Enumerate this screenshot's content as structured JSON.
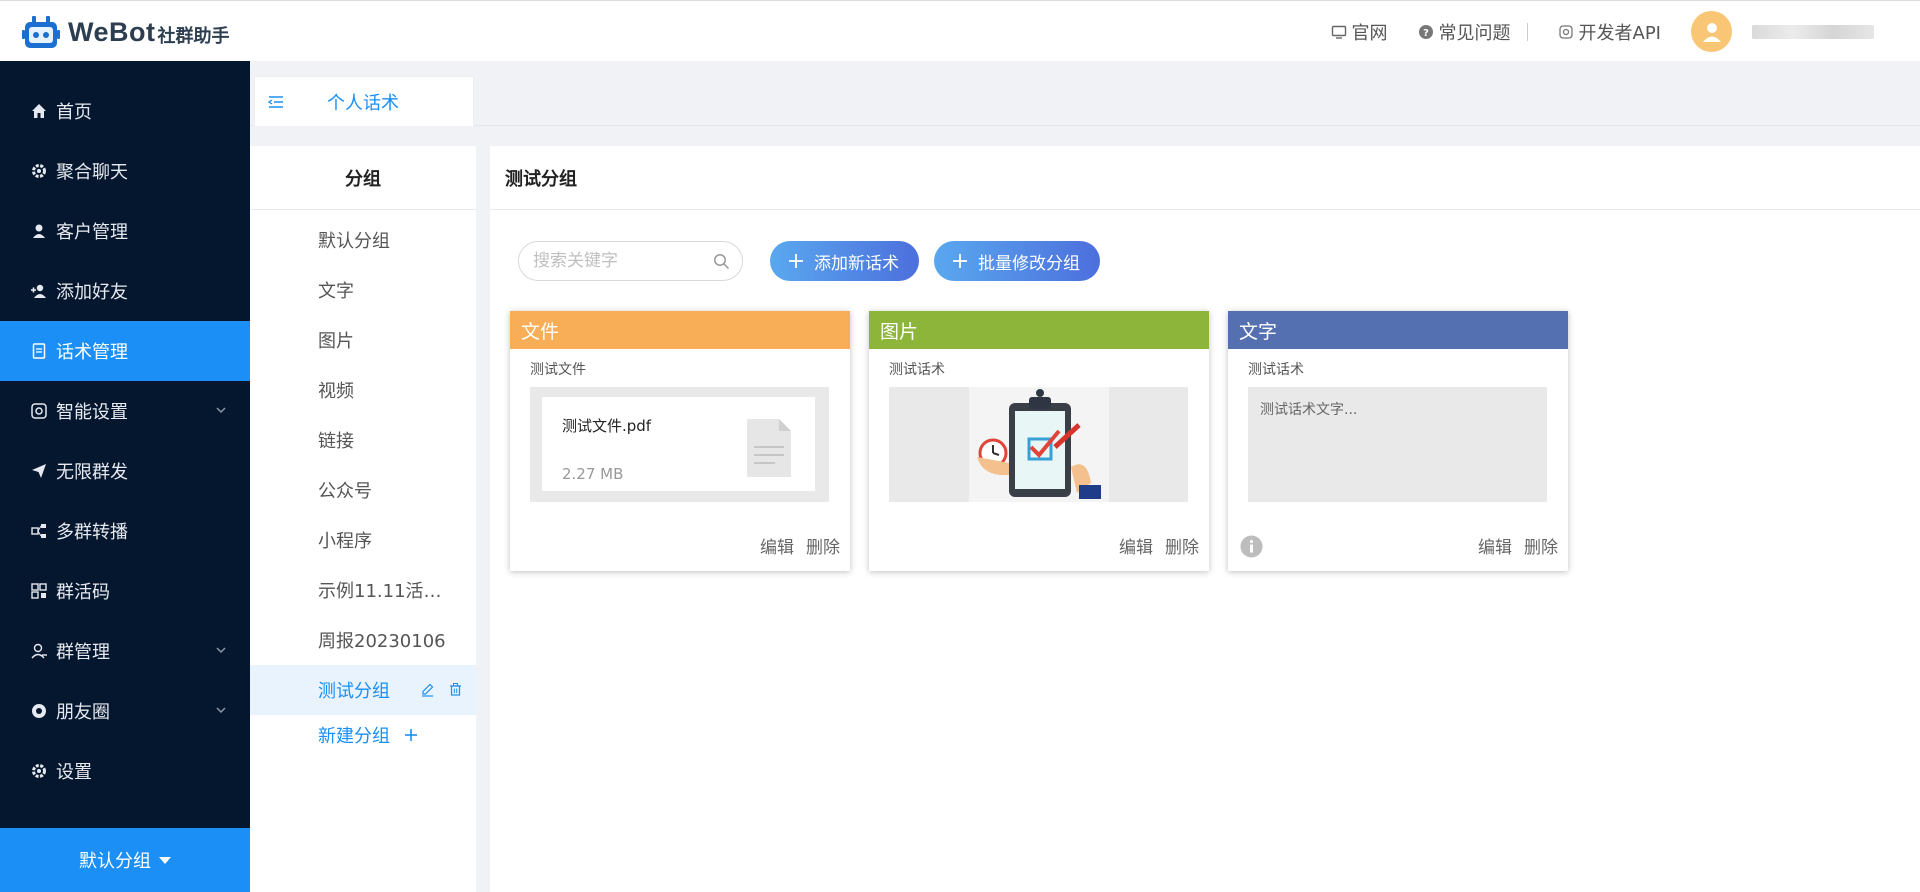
{
  "app": {
    "brand": "WeBot",
    "brand_sub": "社群助手",
    "accent": "#1b8ff5",
    "sidebar_bg": "#05172f"
  },
  "header": {
    "links": [
      {
        "label": "官网",
        "icon": "monitor-icon"
      },
      {
        "label": "常见问题",
        "icon": "question-circle-icon"
      },
      {
        "label": "开发者API",
        "icon": "api-icon"
      }
    ]
  },
  "sidebar": {
    "items": [
      {
        "label": "首页",
        "icon": "home-icon"
      },
      {
        "label": "聚合聊天",
        "icon": "gear-icon"
      },
      {
        "label": "客户管理",
        "icon": "user-icon"
      },
      {
        "label": "添加好友",
        "icon": "add-user-icon"
      },
      {
        "label": "话术管理",
        "icon": "document-icon",
        "active": true
      },
      {
        "label": "智能设置",
        "icon": "smart-settings-icon",
        "expandable": true
      },
      {
        "label": "无限群发",
        "icon": "send-icon"
      },
      {
        "label": "多群转播",
        "icon": "broadcast-icon"
      },
      {
        "label": "群活码",
        "icon": "qrcode-icon"
      },
      {
        "label": "群管理",
        "icon": "group-icon",
        "expandable": true
      },
      {
        "label": "朋友圈",
        "icon": "aperture-icon",
        "expandable": true
      },
      {
        "label": "设置",
        "icon": "gear-icon"
      }
    ],
    "bottom_label": "默认分组"
  },
  "tabs": [
    {
      "label": "个人话术",
      "active": true
    }
  ],
  "groups": {
    "title": "分组",
    "items": [
      "默认分组",
      "文字",
      "图片",
      "视频",
      "链接",
      "公众号",
      "小程序",
      "示例11.11活…",
      "周报20230106",
      "测试分组"
    ],
    "active_index": 9,
    "new_label": "新建分组"
  },
  "content": {
    "title": "测试分组",
    "search_placeholder": "搜索关键字",
    "add_button": "添加新话术",
    "batch_button": "批量修改分组",
    "cards": [
      {
        "type_label": "文件",
        "color": "#f7ae56",
        "name": "测试文件",
        "file_name": "测试文件.pdf",
        "file_size": "2.27 MB",
        "edit": "编辑",
        "delete": "删除"
      },
      {
        "type_label": "图片",
        "color": "#8db53a",
        "name": "测试话术",
        "edit": "编辑",
        "delete": "删除"
      },
      {
        "type_label": "文字",
        "color": "#5470b0",
        "name": "测试话术",
        "text": "测试话术文字...",
        "edit": "编辑",
        "delete": "删除"
      }
    ]
  }
}
